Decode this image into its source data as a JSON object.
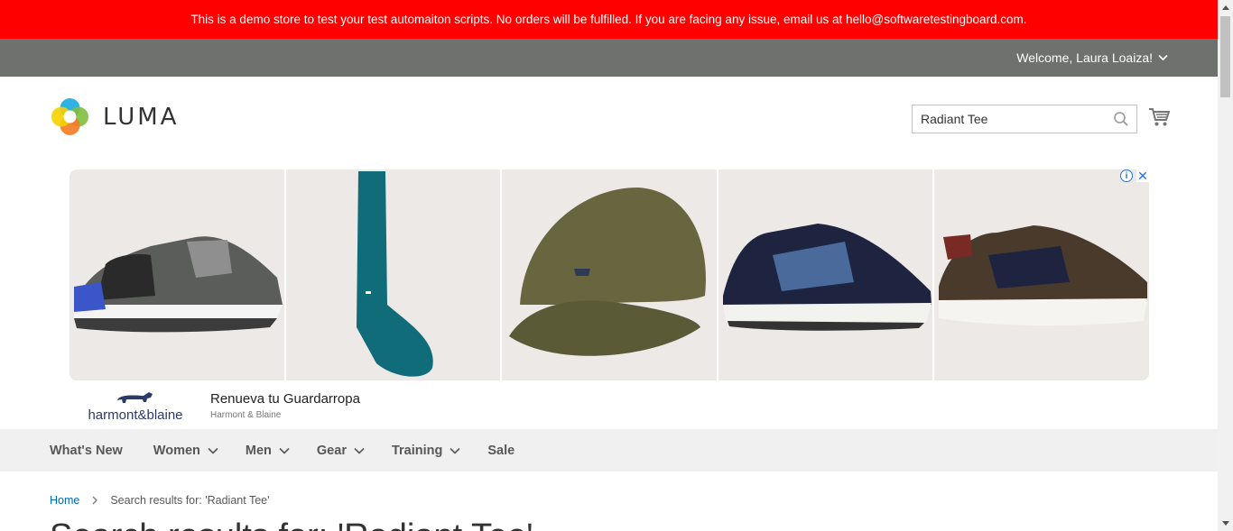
{
  "banner": {
    "text": "This is a demo store to test your test automaiton scripts. No orders will be fulfilled. If you are facing any issue, email us at hello@softwaretestingboard.com."
  },
  "header": {
    "welcome": "Welcome, Laura Loaiza!"
  },
  "logo": {
    "text": "LUMA"
  },
  "search": {
    "value": "Radiant Tee"
  },
  "ad": {
    "brand_name": "harmont&blaine",
    "headline": "Renueva tu Guardarropa",
    "advertiser": "Harmont & Blaine",
    "info_label": "i",
    "close_label": "✕",
    "tiles": [
      "sneaker-grey-icon",
      "sock-teal-icon",
      "cap-olive-icon",
      "sneaker-navy-icon",
      "sneaker-brown-icon"
    ]
  },
  "nav": {
    "items": [
      {
        "label": "What's New",
        "dropdown": false
      },
      {
        "label": "Women",
        "dropdown": true
      },
      {
        "label": "Men",
        "dropdown": true
      },
      {
        "label": "Gear",
        "dropdown": true
      },
      {
        "label": "Training",
        "dropdown": true
      },
      {
        "label": "Sale",
        "dropdown": false
      }
    ]
  },
  "breadcrumbs": {
    "home": "Home",
    "current": "Search results for: 'Radiant Tee'"
  },
  "page": {
    "title": "Search results for: 'Radiant Tee'"
  },
  "colors": {
    "banner": "#ff0000",
    "panel": "#6e716e",
    "link": "#006bb4",
    "nav_bg": "#f0f0f0"
  }
}
